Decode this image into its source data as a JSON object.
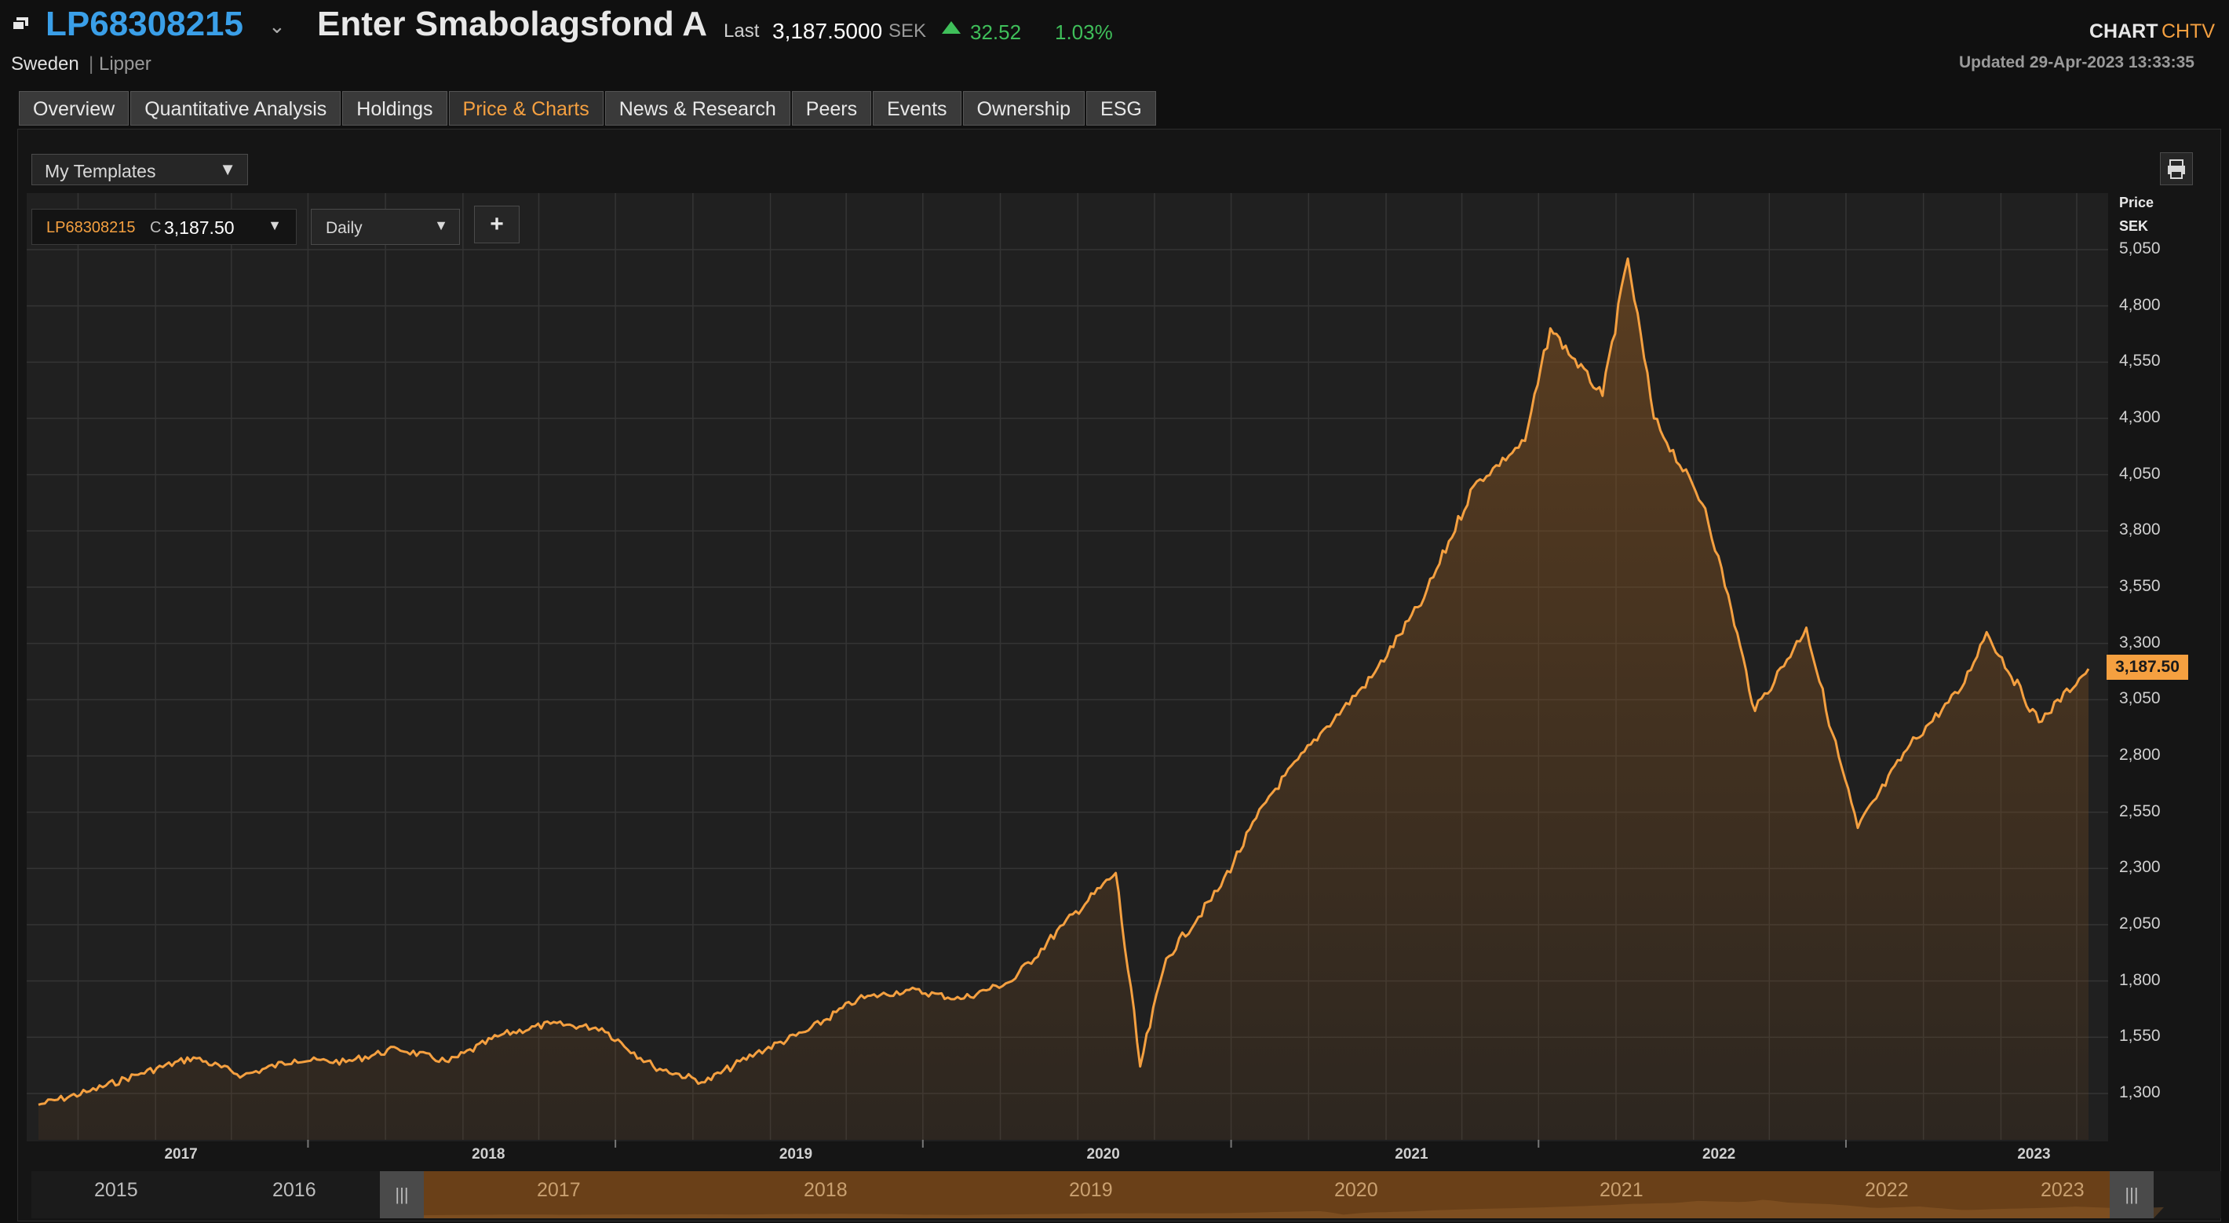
{
  "header": {
    "ticker": "LP68308215",
    "fund_name": "Enter Smabolagsfond A",
    "last_label": "Last",
    "last_value": "3,187.5000",
    "currency": "SEK",
    "change": "32.52",
    "change_pct": "1.03%",
    "country": "Sweden",
    "source": "Lipper",
    "chart_label": "CHART",
    "chart_code": "CHTV",
    "updated": "Updated 29-Apr-2023   13:33:35"
  },
  "tabs": [
    {
      "label": "Overview",
      "active": false
    },
    {
      "label": "Quantitative Analysis",
      "active": false
    },
    {
      "label": "Holdings",
      "active": false
    },
    {
      "label": "Price & Charts",
      "active": true
    },
    {
      "label": "News & Research",
      "active": false
    },
    {
      "label": "Peers",
      "active": false
    },
    {
      "label": "Events",
      "active": false
    },
    {
      "label": "Ownership",
      "active": false
    },
    {
      "label": "ESG",
      "active": false
    }
  ],
  "toolbar": {
    "templates_label": "My Templates",
    "symbol": "LP68308215",
    "symbol_field": "C",
    "symbol_value": "3,187.50",
    "interval": "Daily",
    "add_label": "+"
  },
  "colors": {
    "line": "#f5a040",
    "up": "#3fbf5a",
    "ticker": "#3a9fe8"
  },
  "navigator": {
    "years": [
      "2015",
      "2016",
      "2017",
      "2018",
      "2019",
      "2020",
      "2021",
      "2022",
      "2023"
    ]
  },
  "chart_data": {
    "type": "area",
    "ylabel": "Price",
    "yunit": "SEK",
    "ylim": [
      1150,
      5150
    ],
    "yticks": [
      "1,300",
      "1,550",
      "1,800",
      "2,050",
      "2,300",
      "2,550",
      "2,800",
      "3,050",
      "3,300",
      "3,550",
      "3,800",
      "4,050",
      "4,300",
      "4,550",
      "4,800",
      "5,050"
    ],
    "xticks": [
      "2017",
      "2018",
      "2019",
      "2020",
      "2021",
      "2022",
      "2023"
    ],
    "grid": true,
    "last_label": "3,187.50",
    "x": [
      "2016-08",
      "2016-10",
      "2016-12",
      "2017-02",
      "2017-04",
      "2017-06",
      "2017-08",
      "2017-10",
      "2017-12",
      "2018-02",
      "2018-04",
      "2018-06",
      "2018-08",
      "2018-10",
      "2018-12",
      "2019-02",
      "2019-04",
      "2019-06",
      "2019-08",
      "2019-10",
      "2019-12",
      "2020-02",
      "2020-03",
      "2020-04",
      "2020-06",
      "2020-08",
      "2020-10",
      "2020-12",
      "2021-02",
      "2021-04",
      "2021-06",
      "2021-07",
      "2021-09",
      "2021-10",
      "2021-11",
      "2022-01",
      "2022-02",
      "2022-03",
      "2022-05",
      "2022-06",
      "2022-07",
      "2022-09",
      "2022-11",
      "2022-12",
      "2023-02",
      "2023-04"
    ],
    "series": [
      {
        "values": [
          1250,
          1310,
          1390,
          1460,
          1380,
          1450,
          1440,
          1500,
          1440,
          1560,
          1610,
          1590,
          1420,
          1350,
          1480,
          1580,
          1720,
          1760,
          1720,
          1800,
          2050,
          2280,
          1420,
          1900,
          2200,
          2620,
          2900,
          3150,
          3500,
          4000,
          4200,
          4700,
          4400,
          5010,
          4300,
          3900,
          3450,
          3000,
          3370,
          2900,
          2480,
          2850,
          3100,
          3350,
          2950,
          3187
        ]
      }
    ]
  }
}
